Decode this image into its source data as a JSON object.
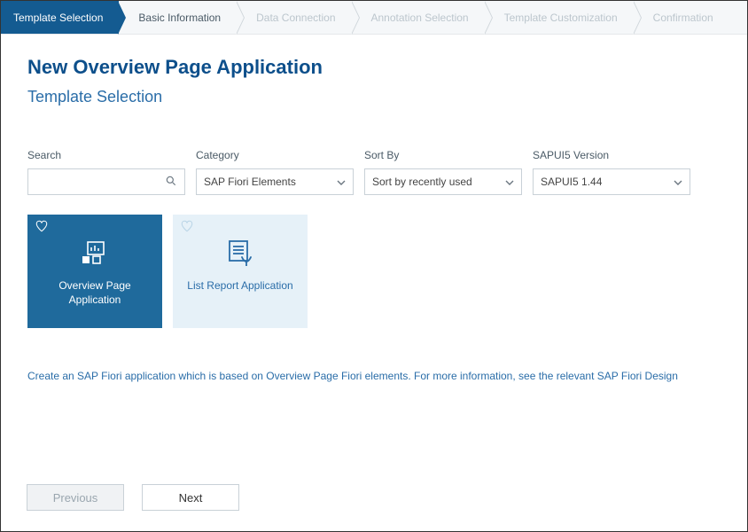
{
  "wizard": {
    "steps": [
      {
        "label": "Template Selection",
        "state": "active"
      },
      {
        "label": "Basic Information",
        "state": "next"
      },
      {
        "label": "Data Connection",
        "state": "disabled"
      },
      {
        "label": "Annotation Selection",
        "state": "disabled"
      },
      {
        "label": "Template Customization",
        "state": "disabled"
      },
      {
        "label": "Confirmation",
        "state": "disabled"
      }
    ]
  },
  "page": {
    "title": "New Overview Page Application",
    "subtitle": "Template Selection"
  },
  "filters": {
    "search": {
      "label": "Search",
      "value": ""
    },
    "category": {
      "label": "Category",
      "value": "SAP Fiori Elements"
    },
    "sort": {
      "label": "Sort By",
      "value": "Sort by recently used"
    },
    "version": {
      "label": "SAPUI5 Version",
      "value": "SAPUI5 1.44"
    }
  },
  "tiles": [
    {
      "label": "Overview Page Application",
      "selected": true
    },
    {
      "label": "List Report Application",
      "selected": false
    }
  ],
  "description": "Create an SAP Fiori application which is based on Overview Page Fiori elements. For more information, see the relevant SAP Fiori Design",
  "nav": {
    "previous": "Previous",
    "next": "Next"
  },
  "colors": {
    "primary": "#145b91",
    "accent": "#2a6da8",
    "tileSelected": "#1f6a9c",
    "tileUnselected": "#e6f1f8"
  }
}
